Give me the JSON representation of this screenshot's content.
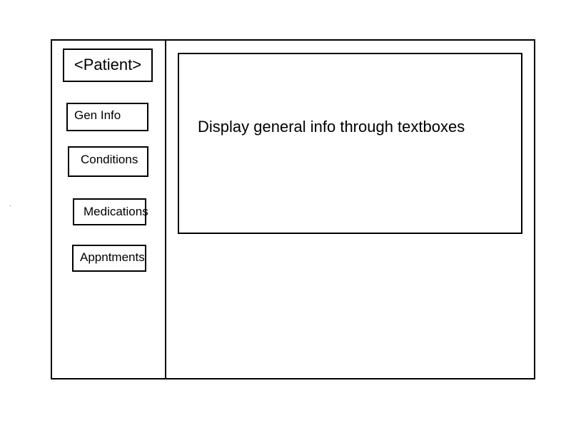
{
  "patient": {
    "title": "<Patient>"
  },
  "sidebar": {
    "items": [
      {
        "label": "Gen Info"
      },
      {
        "label": "Conditions"
      },
      {
        "label": "Medications"
      },
      {
        "label": "Appntments"
      }
    ]
  },
  "main": {
    "display_text": "Display general info through textboxes"
  }
}
